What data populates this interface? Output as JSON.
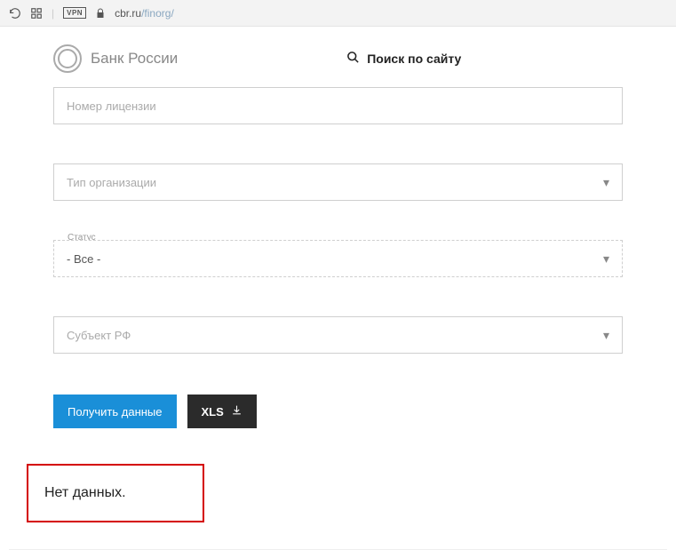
{
  "browser": {
    "vpn_label": "VPN",
    "url_host": "cbr.ru",
    "url_path": "/finorg/"
  },
  "header": {
    "site_name": "Банк России",
    "search_label": "Поиск по сайту"
  },
  "form": {
    "license": {
      "placeholder": "Номер лицензии"
    },
    "org_type": {
      "placeholder": "Тип организации"
    },
    "status": {
      "label": "Статус",
      "value": "- Все -"
    },
    "region": {
      "placeholder": "Субъект РФ"
    }
  },
  "buttons": {
    "submit": "Получить данные",
    "xls": "XLS"
  },
  "result": {
    "no_data": "Нет данных."
  }
}
